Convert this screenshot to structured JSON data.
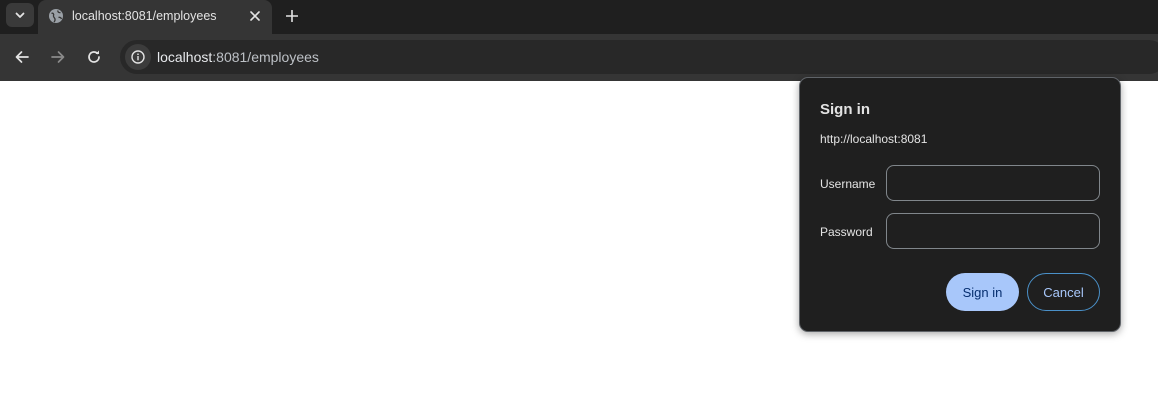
{
  "browser": {
    "tab": {
      "title": "localhost:8081/employees"
    },
    "omnibox": {
      "host": "localhost",
      "path": ":8081/employees"
    }
  },
  "dialog": {
    "title": "Sign in",
    "origin": "http://localhost:8081",
    "username_label": "Username",
    "username_value": "",
    "password_label": "Password",
    "password_value": "",
    "signin_label": "Sign in",
    "cancel_label": "Cancel"
  },
  "icons": {
    "tab_search": "chevron-down-icon",
    "favicon": "globe-icon",
    "tab_close": "close-icon",
    "new_tab": "plus-icon",
    "back": "arrow-left-icon",
    "forward": "arrow-right-icon",
    "reload": "reload-icon",
    "site_info": "info-icon"
  },
  "colors": {
    "tabstrip": "#1f1f1f",
    "toolbar": "#353535",
    "dialog_bg": "#1f1f1f",
    "primary_button": "#a8c7fa",
    "cancel_border": "#4a90c8"
  }
}
